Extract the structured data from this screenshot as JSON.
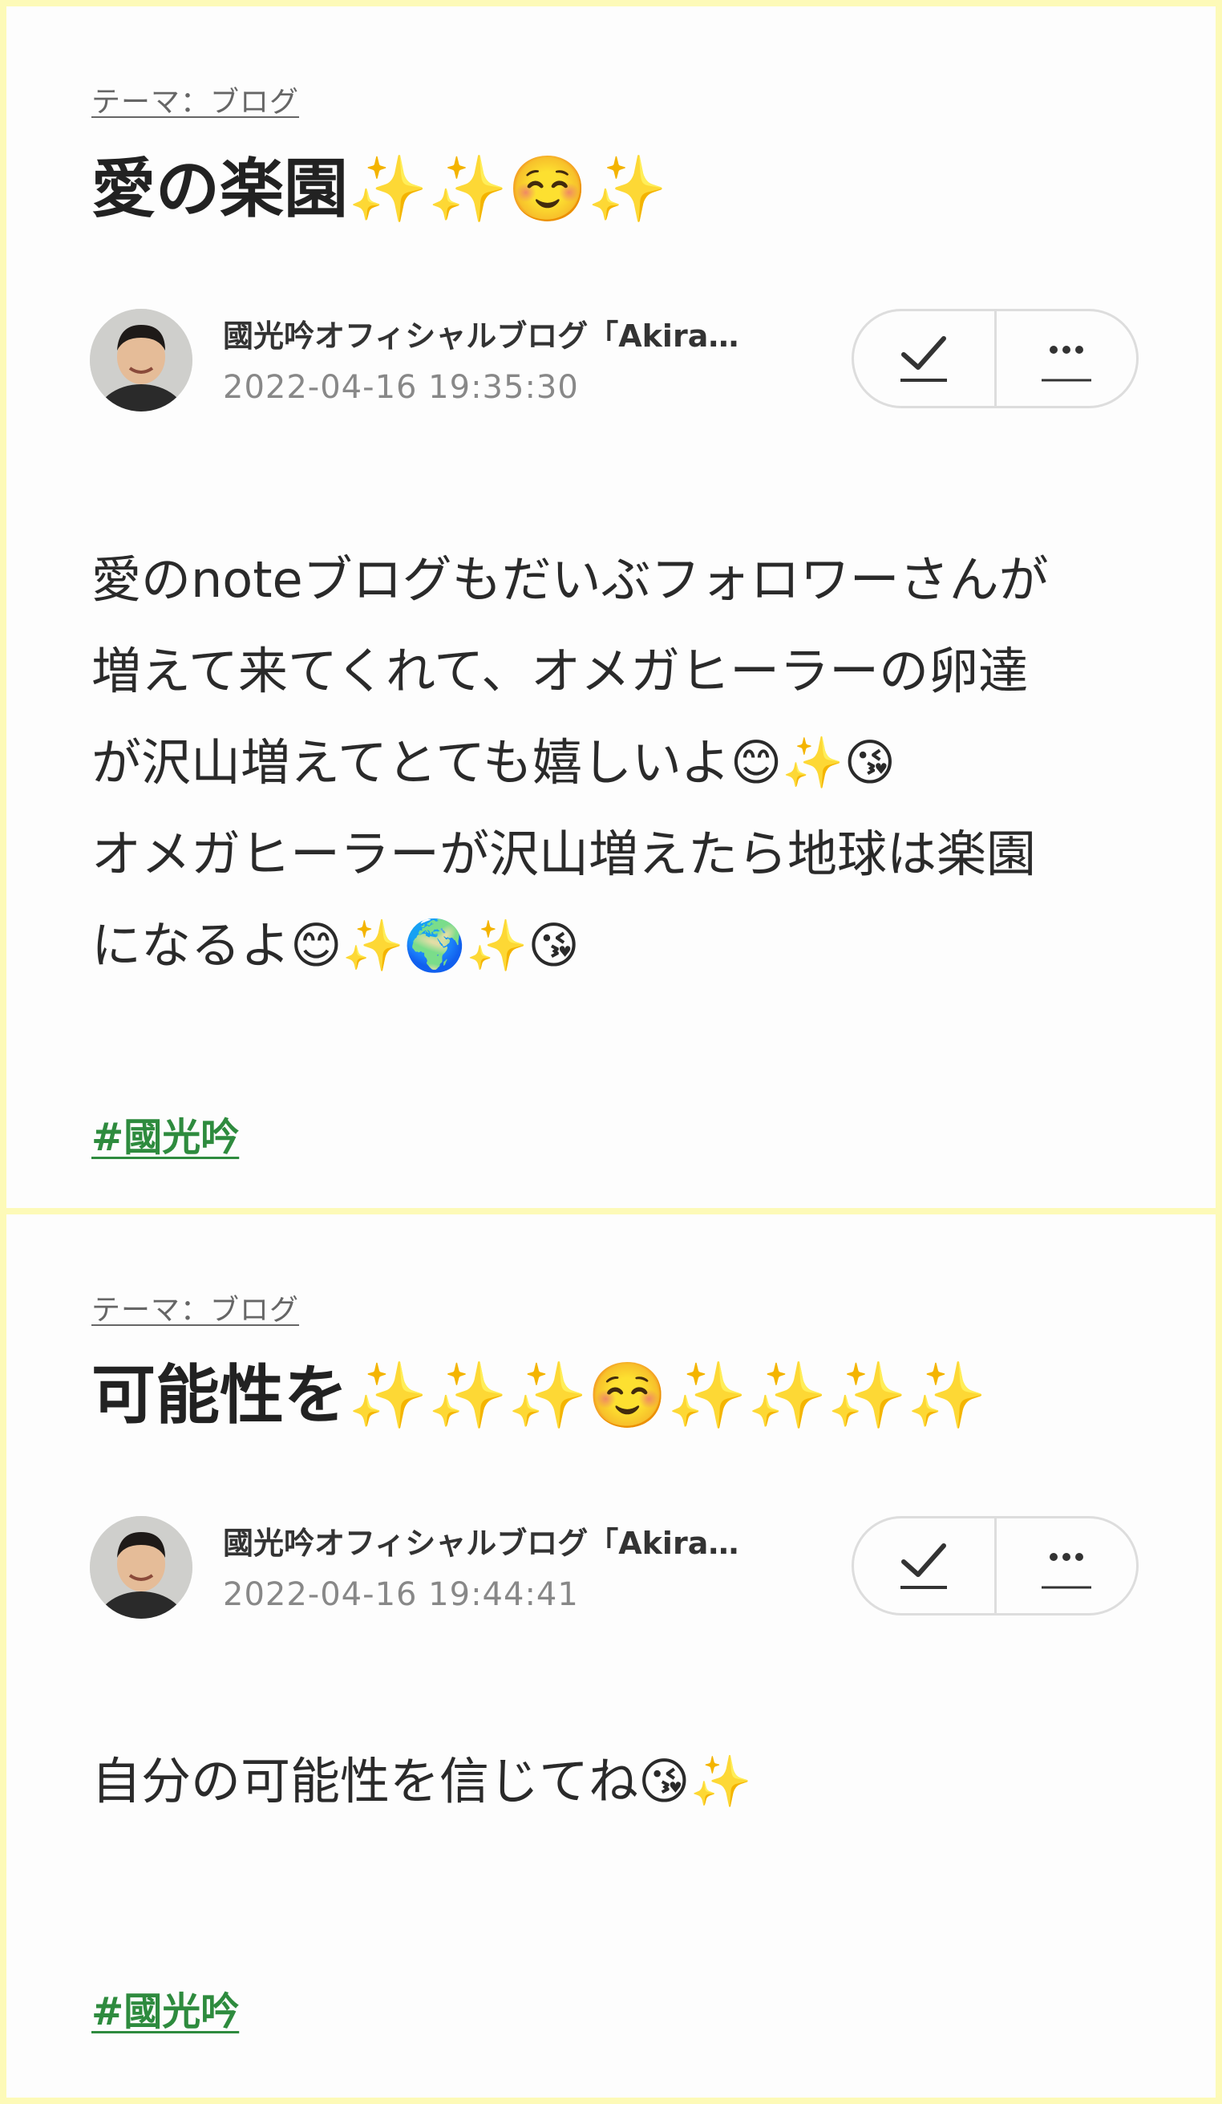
{
  "posts": [
    {
      "theme": "テーマ：ブログ",
      "title": "愛の楽園✨✨☺️✨",
      "author": "國光吟オフィシャルブログ「Akira…",
      "datetime": "2022-04-16 19:35:30",
      "actions": {
        "check_icon": "checkmark-icon",
        "more_icon": "more-dots-icon"
      },
      "body_lines": [
        "愛のnoteブログもだいぶフォロワーさんが",
        "増えて来てくれて、オメガヒーラーの卵達",
        "が沢山増えてとても嬉しいよ😊✨😘",
        "オメガヒーラーが沢山増えたら地球は楽園",
        "になるよ😊✨🌍✨😘"
      ],
      "hashtag": "#國光吟"
    },
    {
      "theme": "テーマ：ブログ",
      "title": "可能性を✨✨✨☺️✨✨✨✨",
      "author": "國光吟オフィシャルブログ「Akira…",
      "datetime": "2022-04-16 19:44:41",
      "actions": {
        "check_icon": "checkmark-icon",
        "more_icon": "more-dots-icon"
      },
      "body_lines": [
        "自分の可能性を信じてね😘✨"
      ],
      "hashtag": "#國光吟"
    }
  ],
  "colors": {
    "page_border": "#fdfab8",
    "card_background": "#fdfdfd",
    "hashtag": "#2e8b3e",
    "meta_gray": "#888888"
  }
}
